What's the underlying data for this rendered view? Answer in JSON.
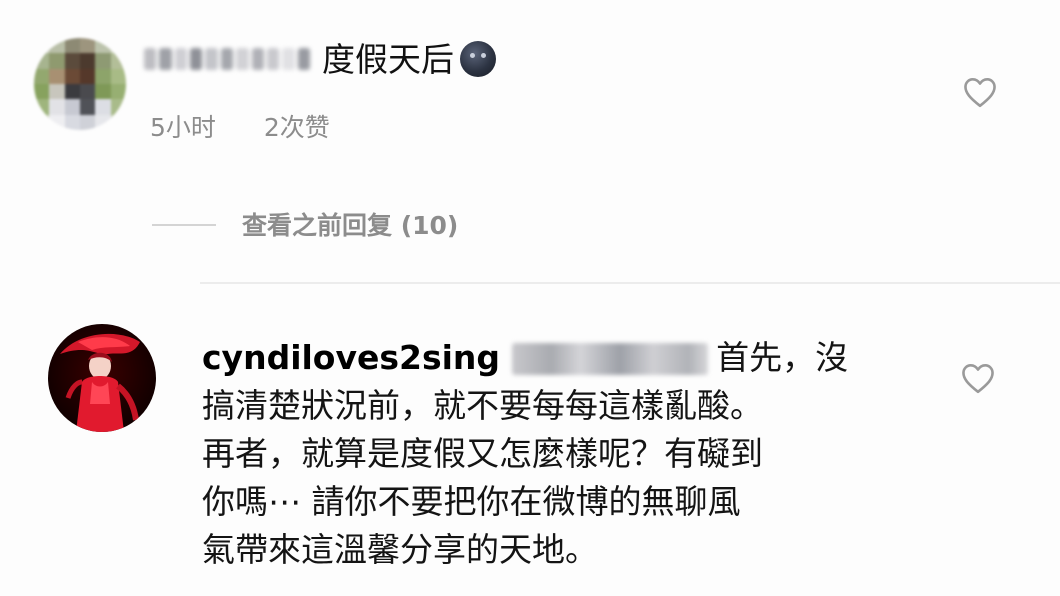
{
  "comment1": {
    "username": "",
    "text": "度假天后",
    "emoji": "new-moon-face-emoji",
    "time": "5小时",
    "likes": "2次赞"
  },
  "replies": {
    "label": "查看之前回复 (10)"
  },
  "comment2": {
    "username": "cyndiloves2sing",
    "lines": [
      "首先，沒",
      "搞清楚狀況前，就不要每每這樣亂酸。",
      "再者，就算是度假又怎麼樣呢？有礙到",
      "你嗎⋯ 請你不要把你在微博的無聊風",
      "氣帶來這溫馨分享的天地。"
    ]
  },
  "colors": {
    "meta_text": "#8c8c8c",
    "heart_stroke": "#9a9a9a",
    "divider": "#ececec"
  }
}
